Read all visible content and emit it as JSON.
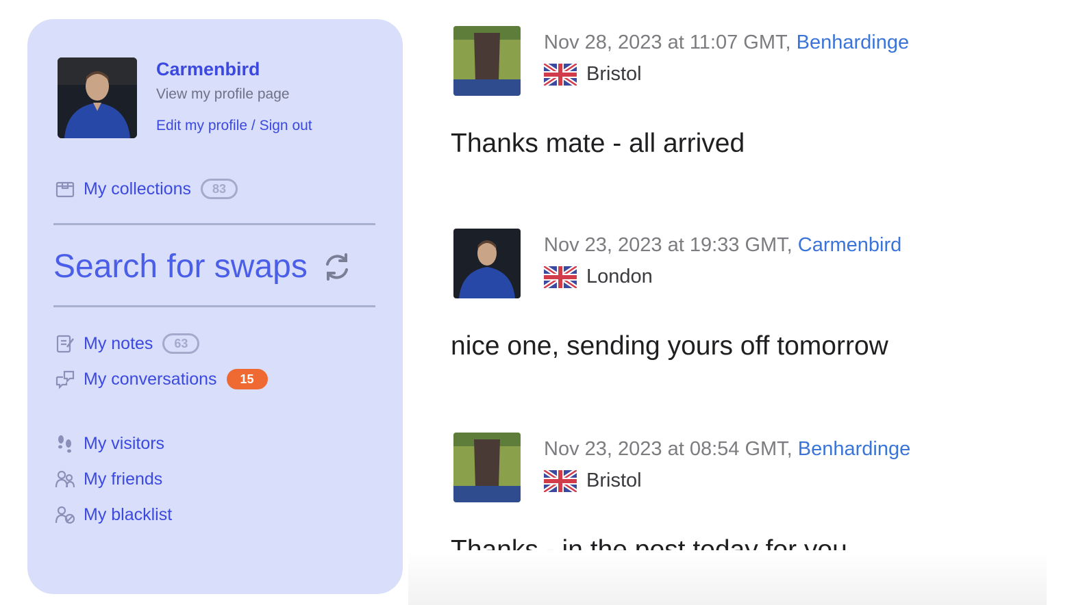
{
  "user": {
    "name": "Carmenbird",
    "profile_subtext": "View my profile page",
    "edit_link": "Edit my profile",
    "link_separator": "/",
    "sign_out_link": "Sign out"
  },
  "menu": {
    "collections": {
      "label": "My collections",
      "count": "83",
      "icon": "box-icon"
    },
    "search_swaps": {
      "label": "Search for swaps",
      "icon": "swap-arrows-icon"
    },
    "notes": {
      "label": "My notes",
      "count": "63",
      "icon": "notepad-icon"
    },
    "conversations": {
      "label": "My conversations",
      "count": "15",
      "icon": "chat-icon"
    },
    "visitors": {
      "label": "My visitors",
      "icon": "footsteps-icon"
    },
    "friends": {
      "label": "My friends",
      "icon": "friends-icon"
    },
    "blacklist": {
      "label": "My blacklist",
      "icon": "blacklist-icon"
    }
  },
  "posts": [
    {
      "date": "Nov 28, 2023 at 11:07 GMT, ",
      "author": "Benhardinge",
      "location": "Bristol",
      "flag": "uk-flag",
      "text": "Thanks mate - all arrived"
    },
    {
      "date": "Nov 23, 2023 at 19:33 GMT, ",
      "author": "Carmenbird",
      "location": "London",
      "flag": "uk-flag",
      "text": "nice one, sending yours off tomorrow"
    },
    {
      "date": "Nov 23, 2023 at 08:54 GMT, ",
      "author": "Benhardinge",
      "location": "Bristol",
      "flag": "uk-flag",
      "text": "Thanks - in the post today for you"
    }
  ],
  "colors": {
    "sidebar_bg": "#d9dffa",
    "link": "#3b49e0",
    "author_link": "#3b74d9",
    "alert_badge": "#ef6a33"
  }
}
